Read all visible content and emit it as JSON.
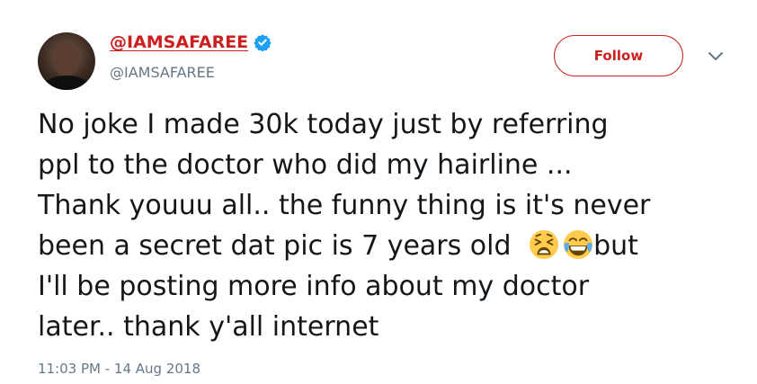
{
  "author": {
    "display_name": "@IAMSAFAREE",
    "handle": "@IAMSAFAREE",
    "verified": true,
    "avatar_icon": "avatar-photo"
  },
  "follow_button": {
    "label": "Follow"
  },
  "menu": {
    "icon": "chevron-down-icon"
  },
  "tweet": {
    "line1": "No joke I made 30k today just by referring",
    "line2": "ppl to the doctor who did my hairline ...",
    "line3": "Thank youuu all.. the funny thing is it's never",
    "line4_before_emoji": "been a secret dat pic is 7 years old ",
    "emojis": [
      "weary-face-emoji",
      "crying-laughing-emoji"
    ],
    "line4_after_emoji": "but",
    "line5": "I'll be posting more info about my doctor",
    "line6": "later.. thank y'all internet"
  },
  "timestamp": "11:03 PM - 14 Aug 2018",
  "colors": {
    "accent": "#cc1f1f",
    "verified": "#1da1f2",
    "muted": "#657786",
    "text": "#14171a"
  }
}
